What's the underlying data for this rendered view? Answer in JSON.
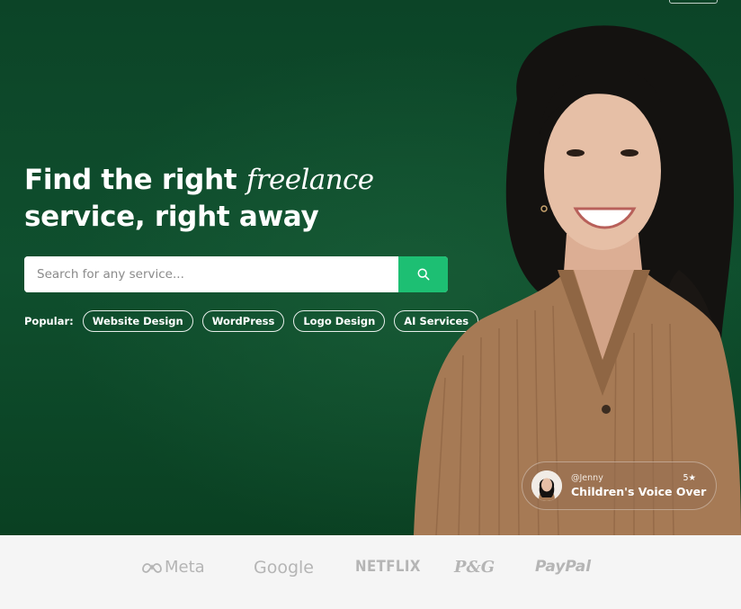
{
  "hero": {
    "title_line1_prefix": "Find the right ",
    "title_line1_emphasis": "freelance",
    "title_line2": "service, right away",
    "search": {
      "placeholder": "Search for any service..."
    },
    "popular": {
      "label": "Popular:",
      "tags": [
        "Website Design",
        "WordPress",
        "Logo Design",
        "AI Services"
      ]
    },
    "profile_card": {
      "handle": "@Jenny",
      "rating": "5★",
      "service": "Children's Voice Over"
    }
  },
  "trusted_by": {
    "logos": [
      "Meta",
      "Google",
      "NETFLIX",
      "P&G",
      "PayPal"
    ]
  },
  "colors": {
    "hero_background": "#0d4a29",
    "accent": "#1dbf73",
    "trusted_background": "#f5f5f5",
    "logo_gray": "#b5b5b5"
  },
  "icons": [
    "search-icon",
    "meta-infinity-icon",
    "star-icon"
  ]
}
